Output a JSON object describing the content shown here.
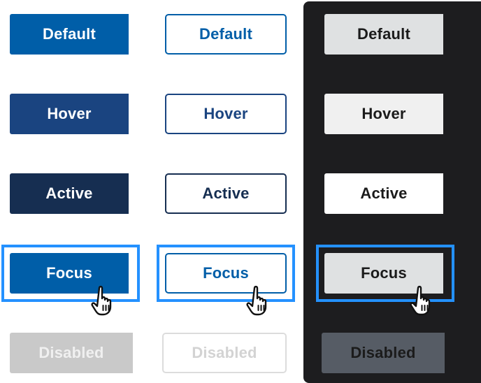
{
  "columns": {
    "primary": {
      "default": "Default",
      "hover": "Hover",
      "active": "Active",
      "focus": "Focus",
      "disabled": "Disabled"
    },
    "outline": {
      "default": "Default",
      "hover": "Hover",
      "active": "Active",
      "focus": "Focus",
      "disabled": "Disabled"
    },
    "inverse": {
      "default": "Default",
      "hover": "Hover",
      "active": "Active",
      "focus": "Focus",
      "disabled": "Disabled"
    }
  },
  "colors": {
    "primary": "#005ea8",
    "primary_hover": "#1a4480",
    "primary_active": "#162e51",
    "focus_ring": "#2491ff",
    "disabled": "#c9c9c9",
    "dark_background": "#1d1d1f",
    "inverse_default": "#dfe1e2",
    "inverse_disabled": "#565c65"
  },
  "icons": {
    "cursor": "hand-pointer-icon"
  }
}
